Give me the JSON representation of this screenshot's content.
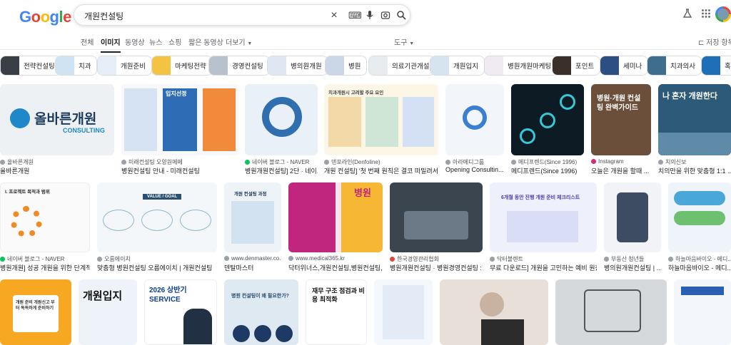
{
  "search": {
    "query": "개원컨설팅"
  },
  "logo": {
    "letters": [
      "G",
      "o",
      "o",
      "g",
      "l",
      "e"
    ],
    "colors": [
      "#4285f4",
      "#ea4335",
      "#fbbc05",
      "#4285f4",
      "#34a853",
      "#ea4335"
    ]
  },
  "tabs": [
    "전체",
    "이미지",
    "동영상",
    "뉴스",
    "쇼핑",
    "짧은 동영상",
    "더보기"
  ],
  "tools_label": "도구",
  "save_label": "저장 항목",
  "chips": [
    "전략컨설팅",
    "치과",
    "개원준비",
    "마케팅전략",
    "경영컨설팅",
    "병의원개원",
    "병원",
    "의료기관개설",
    "개원입지",
    "병원개원마케팅",
    "포인트",
    "세미나",
    "치과의사",
    "혹"
  ],
  "row1": [
    {
      "source": "올바른개원",
      "caption": "올바른개원",
      "text": "올바른개원",
      "sub": "CONSULTING"
    },
    {
      "source": "미래컨설팅 오양원메메",
      "caption": "병원컨설팅 안내 - 미래컨설팅",
      "text": "입지선정"
    },
    {
      "source": "네이버 블로그 - NAVER",
      "caption": "병원개원컨설팅] 2단 · 네이...",
      "text": ""
    },
    {
      "source": "덴포라인(Denfoline)",
      "caption": "개원 컨설팅] '첫 번째 원칙은 결코 떠밀려서 ...",
      "text": "치과개원시 고려할 주요 요인"
    },
    {
      "source": "아라메디그룹",
      "caption": "Opening Consultin...",
      "text": ""
    },
    {
      "source": "메디프렌드(Since 1996)",
      "caption": "메디프렌드(Since 1996)",
      "text": ""
    },
    {
      "source": "Instagram",
      "caption": "오늘은 개원을 할때 ...",
      "text": "병원·개원 컨설팅 완벽가이드"
    },
    {
      "source": "치의신보",
      "caption": "치의만을 위한 맞춤형 1:1 ...",
      "text": "나 혼자 개원한다"
    }
  ],
  "row2": [
    {
      "source": "네이버 블로그 - NAVER",
      "caption": "병원개원] 성공 개원을 위한 단계적 ...",
      "text": "I. 프로젝트 목적과 범위"
    },
    {
      "source": "오름에이치",
      "caption": "맞춤형 병원컨설팅 오름에이치 | 개원컨설팅",
      "text": "VALUE / GOAL"
    },
    {
      "source": "www.denmaster.co.kr",
      "caption": "덴탈마스터",
      "text": "개원 컨설팅 과정"
    },
    {
      "source": "www.medical365.kr",
      "caption": "닥터위너스,개원컨설팅,병원컨설팅,...",
      "text": "병원"
    },
    {
      "source": "한국경영관리협회",
      "caption": "병원개원컨설팅 · 병원경영컨설팅 : ...",
      "text": ""
    },
    {
      "source": "닥터블렌트",
      "caption": "무료 다운로드] 개원을 고민하는 예비 원장...",
      "text": "6개월 동안 진행 개원 준비 체크리스트"
    },
    {
      "source": "부동산 청년들",
      "caption": "병의원개원컨설팅 | ...",
      "text": ""
    },
    {
      "source": "하늘마음바이오 - 메디...",
      "caption": "하늘마음바이오 - 메디...",
      "text": ""
    }
  ],
  "row3": [
    {
      "text": "개원 준비 개원신고 부터 독독하게 준비하기"
    },
    {
      "text": "개원입지"
    },
    {
      "text": "2026 상반기 SERVICE"
    },
    {
      "text": "병원 컨설팅이 왜 필요한가?"
    },
    {
      "text": "재무 구조 점검과 비용 최적화"
    },
    {
      "text": ""
    },
    {
      "text": ""
    },
    {
      "text": ""
    },
    {
      "text": ""
    }
  ]
}
